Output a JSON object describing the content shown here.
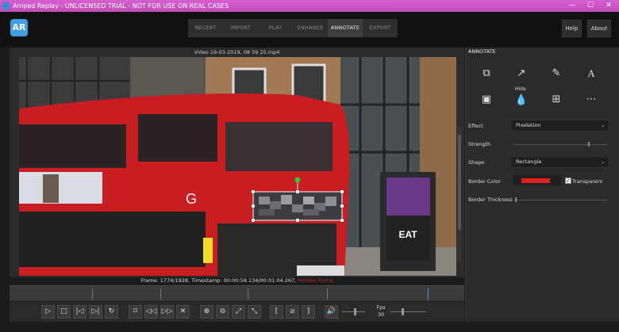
{
  "window": {
    "title": "Amped Replay - UNLICENSED TRIAL - NOT FOR USE ON REAL CASES",
    "minimize": "—",
    "maximize": "☐",
    "close": "✕"
  },
  "app": {
    "logo_text": "AR"
  },
  "nav": {
    "tabs": [
      {
        "label": "RECENT"
      },
      {
        "label": "IMPORT"
      },
      {
        "label": "PLAY"
      },
      {
        "label": "ENHANCE"
      },
      {
        "label": "ANNOTATE"
      },
      {
        "label": "EXPORT"
      }
    ],
    "active": "ANNOTATE",
    "help_label": "Help",
    "about_label": "About"
  },
  "viewer": {
    "video_title": "Video 19-03-2019, 08 59 25.mp4",
    "frame_info": "Frame: 1774/1928, Timestamp: 00:00:59.134/00:01:04.267,",
    "hidden_stamp": "Hidden frame",
    "playback_position": 0.92
  },
  "controls": {
    "fps_label": "Fps",
    "fps_value": "30"
  },
  "panel": {
    "title": "ANNOTATE",
    "tools": [
      {
        "icon": "shapes-icon"
      },
      {
        "icon": "arrow-icon"
      },
      {
        "icon": "pencil-icon"
      },
      {
        "icon": "text-icon"
      },
      {
        "icon": "image-icon"
      },
      {
        "icon": "hide-drop-icon",
        "label": "Hide"
      },
      {
        "icon": "magnify-region-icon"
      },
      {
        "icon": "more-icon"
      }
    ],
    "effect_label": "Effect",
    "effect_value": "Pixelation",
    "strength_label": "Strength",
    "strength_value": 0.8,
    "shape_label": "Shape",
    "shape_value": "Rectangle",
    "border_color_label": "Border Color",
    "border_color": "#e0201c",
    "transparent_label": "Transparent",
    "transparent_checked": true,
    "border_thickness_label": "Border Thickness",
    "border_thickness_value": 0.0
  }
}
